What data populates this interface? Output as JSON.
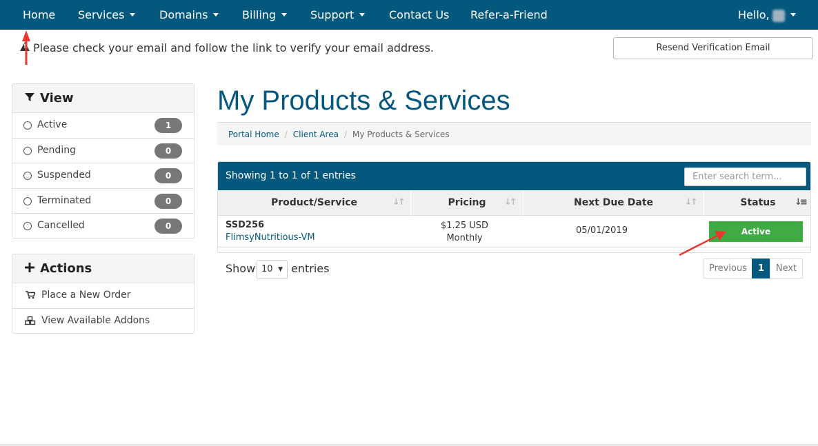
{
  "nav": {
    "items": [
      {
        "label": "Home",
        "dropdown": false
      },
      {
        "label": "Services",
        "dropdown": true
      },
      {
        "label": "Domains",
        "dropdown": true
      },
      {
        "label": "Billing",
        "dropdown": true
      },
      {
        "label": "Support",
        "dropdown": true
      },
      {
        "label": "Contact Us",
        "dropdown": false
      },
      {
        "label": "Refer-a-Friend",
        "dropdown": false
      }
    ],
    "user_greeting": "Hello,"
  },
  "alert": {
    "message": "Please check your email and follow the link to verify your email address.",
    "button_label": "Resend Verification Email"
  },
  "sidebar": {
    "view": {
      "title": "View",
      "items": [
        {
          "label": "Active",
          "count": "1"
        },
        {
          "label": "Pending",
          "count": "0"
        },
        {
          "label": "Suspended",
          "count": "0"
        },
        {
          "label": "Terminated",
          "count": "0"
        },
        {
          "label": "Cancelled",
          "count": "0"
        }
      ]
    },
    "actions": {
      "title": "Actions",
      "items": [
        {
          "label": "Place a New Order",
          "icon": "shopping-cart-icon"
        },
        {
          "label": "View Available Addons",
          "icon": "cubes-icon"
        }
      ]
    }
  },
  "main": {
    "title": "My Products & Services",
    "breadcrumb": [
      "Portal Home",
      "Client Area",
      "My Products & Services"
    ],
    "table": {
      "showing": "Showing 1 to 1 of 1 entries",
      "search_placeholder": "Enter search term...",
      "columns": [
        "Product/Service",
        "Pricing",
        "Next Due Date",
        "Status"
      ],
      "rows": [
        {
          "product": "SSD256",
          "hostname": "FlimsyNutritious-VM",
          "price": "$1.25 USD",
          "cycle": "Monthly",
          "due": "05/01/2019",
          "status": "Active"
        }
      ]
    },
    "length": {
      "show": "Show",
      "value": "10",
      "entries": "entries"
    },
    "pagination": {
      "previous": "Previous",
      "current": "1",
      "next": "Next"
    }
  },
  "colors": {
    "brand": "#04587d",
    "status_active": "#3eab45",
    "annotation": "#e8372f"
  }
}
